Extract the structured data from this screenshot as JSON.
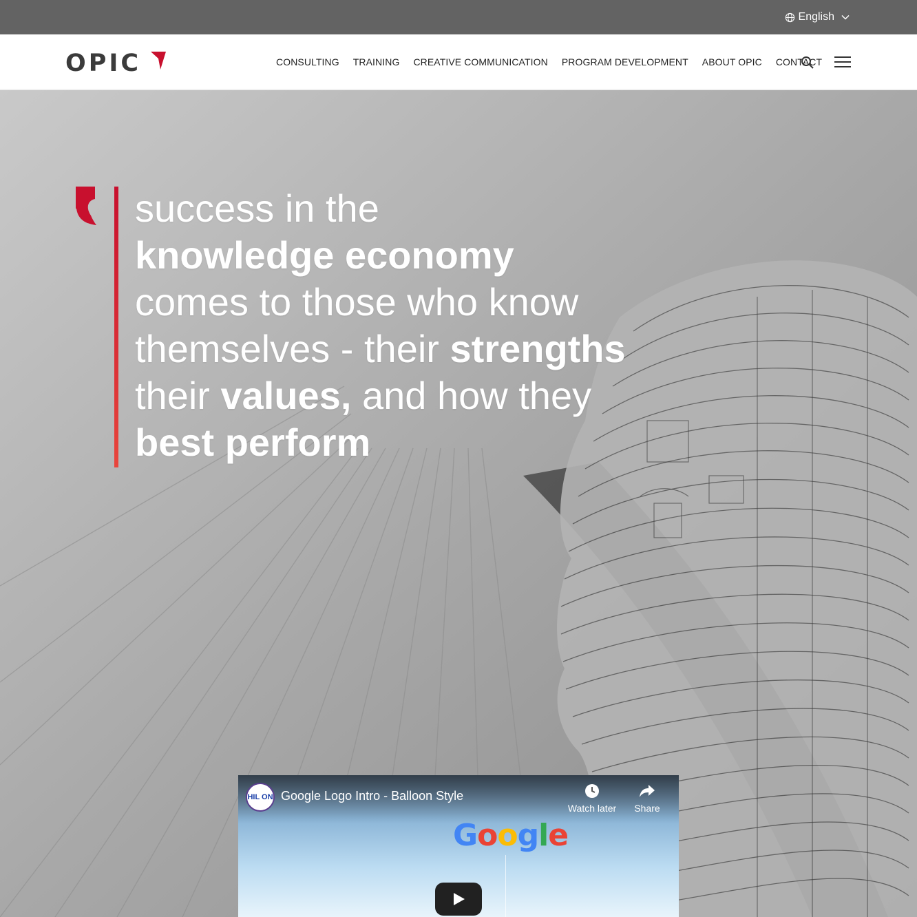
{
  "topbar": {
    "language": "English",
    "icons": [
      "globe-icon",
      "chevron-down-icon"
    ]
  },
  "header": {
    "logo_text": "OPIC",
    "nav": [
      {
        "label": "CONSULTING"
      },
      {
        "label": "TRAINING"
      },
      {
        "label": "CREATIVE COMMUNICATION"
      },
      {
        "label": "PROGRAM DEVELOPMENT"
      },
      {
        "label": "ABOUT OPIC"
      },
      {
        "label": "CONTACT"
      }
    ],
    "icons": [
      "search-icon",
      "hamburger-menu-icon"
    ]
  },
  "hero": {
    "quote": {
      "l1": "success in the",
      "l2": "knowledge economy",
      "l3": "comes to those who know",
      "l4a": "themselves - their ",
      "l4b": "strengths",
      "l5a": "their ",
      "l5b": "values,",
      "l5c": " and how they",
      "l6": "best perform"
    },
    "colors": {
      "accent": "#c8102e",
      "accent_light": "#e8453c",
      "text": "#ffffff"
    }
  },
  "video": {
    "title": "Google Logo Intro - Balloon Style",
    "channel_badge": "HIL ON",
    "watch_later": "Watch later",
    "share": "Share",
    "logo_letters": [
      "G",
      "o",
      "o",
      "g",
      "l",
      "e"
    ],
    "logo_colors": [
      "#4285f4",
      "#ea4335",
      "#fbbc05",
      "#4285f4",
      "#34a853",
      "#ea4335"
    ],
    "icons": [
      "clock-icon",
      "share-arrow-icon",
      "play-icon"
    ]
  }
}
